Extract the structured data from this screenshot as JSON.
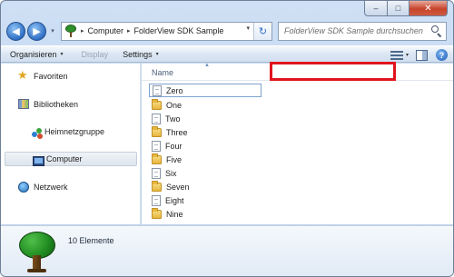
{
  "window": {
    "minimize_glyph": "–",
    "maximize_glyph": "□",
    "close_glyph": "✕"
  },
  "nav": {
    "back_glyph": "◀",
    "forward_glyph": "▶",
    "history_glyph": "▾"
  },
  "address": {
    "crumbs": [
      "Computer",
      "FolderView SDK Sample"
    ],
    "separator": "▸",
    "dropdown_glyph": "▾",
    "refresh_glyph": "↻"
  },
  "search": {
    "placeholder": "FolderView SDK Sample durchsuchen"
  },
  "toolbar": {
    "organize_label": "Organisieren",
    "display_label": "Display",
    "settings_label": "Settings",
    "caret": "▾",
    "help_glyph": "?"
  },
  "navpane": {
    "items": [
      {
        "label": "Favoriten",
        "icon": "star-icon"
      },
      {
        "label": "Bibliotheken",
        "icon": "libraries-icon"
      },
      {
        "label": "Heimnetzgruppe",
        "icon": "homegroup-icon"
      },
      {
        "label": "Computer",
        "icon": "computer-icon",
        "selected": true
      },
      {
        "label": "Netzwerk",
        "icon": "network-icon"
      }
    ],
    "star_glyph": "★"
  },
  "content": {
    "column_name": "Name",
    "sort_glyph": "▲",
    "items": [
      {
        "label": "Zero",
        "type": "file"
      },
      {
        "label": "One",
        "type": "folder"
      },
      {
        "label": "Two",
        "type": "file"
      },
      {
        "label": "Three",
        "type": "folder"
      },
      {
        "label": "Four",
        "type": "file"
      },
      {
        "label": "Five",
        "type": "folder"
      },
      {
        "label": "Six",
        "type": "file"
      },
      {
        "label": "Seven",
        "type": "folder"
      },
      {
        "label": "Eight",
        "type": "file"
      },
      {
        "label": "Nine",
        "type": "folder"
      }
    ]
  },
  "details": {
    "item_count": "10 Elemente"
  },
  "colors": {
    "highlight_box": "#e0141e",
    "selection_border": "#7da2ce"
  }
}
